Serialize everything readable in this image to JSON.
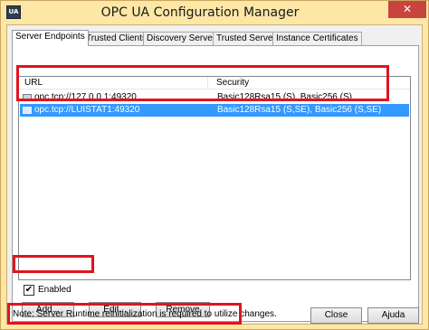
{
  "window": {
    "title": "OPC UA Configuration Manager",
    "close_glyph": "✕",
    "icon_text": "UA"
  },
  "tabs": [
    {
      "label": "Server Endpoints",
      "active": true
    },
    {
      "label": "Trusted Clients",
      "active": false
    },
    {
      "label": "Discovery Servers",
      "active": false
    },
    {
      "label": "Trusted Servers",
      "active": false
    },
    {
      "label": "Instance Certificates",
      "active": false
    }
  ],
  "endpoints": {
    "columns": {
      "url": "URL",
      "security": "Security"
    },
    "rows": [
      {
        "url": "opc.tcp://127.0.0.1:49320",
        "security": "Basic128Rsa15 (S), Basic256 (S)",
        "selected": false,
        "icon": "endpoint-icon"
      },
      {
        "url": "opc.tcp://LUISTAT1:49320",
        "security": "Basic128Rsa15 (S,SE), Basic256 (S,SE)",
        "selected": true,
        "icon": "endpoint-icon"
      }
    ]
  },
  "enabled": {
    "label": "Enabled",
    "checked": true,
    "check_glyph": "✔"
  },
  "buttons": {
    "add": "Add...",
    "edit": "Edit...",
    "remove": "Remove",
    "close": "Close",
    "help": "Ajuda"
  },
  "note": "Note:  Server Runtime reinitialization is required to utilize changes.",
  "colors": {
    "highlight_box": "#e0141f",
    "selection": "#3399ff",
    "title_bar": "#fde7a6"
  }
}
